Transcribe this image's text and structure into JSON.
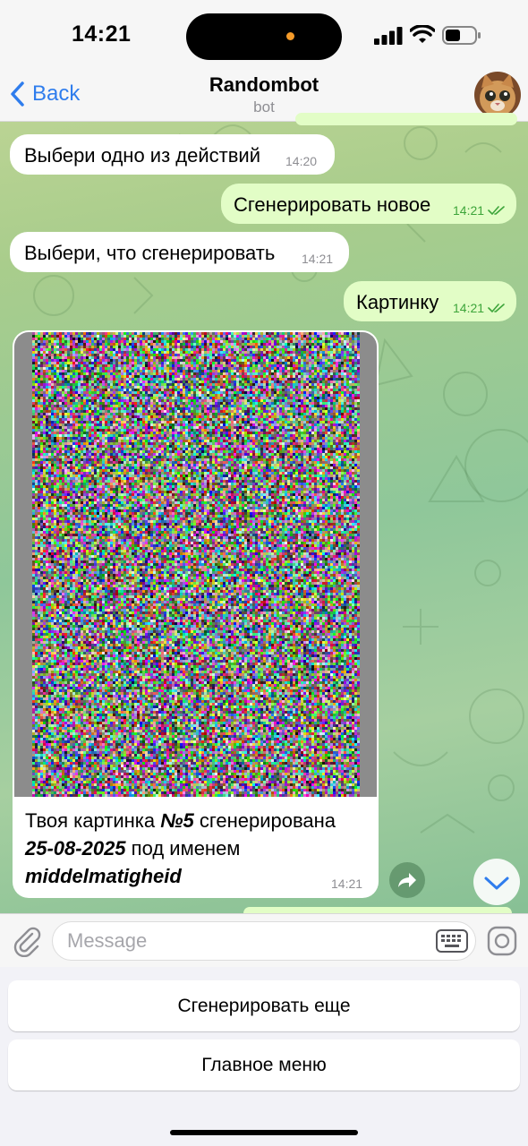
{
  "status_bar": {
    "time": "14:21"
  },
  "header": {
    "back_label": "Back",
    "title": "Randombot",
    "subtitle": "bot"
  },
  "messages": [
    {
      "direction": "in",
      "text": "Выбери одно из действий",
      "time": "14:20"
    },
    {
      "direction": "out",
      "text": "Сгенерировать новое",
      "time": "14:21"
    },
    {
      "direction": "in",
      "text": "Выбери, что сгенерировать",
      "time": "14:21"
    },
    {
      "direction": "out",
      "text": "Картинку",
      "time": "14:21"
    }
  ],
  "image_message": {
    "caption_part1": "Твоя картинка ",
    "caption_number": "№5",
    "caption_part2": " сгенерирована",
    "caption_date": "25-08-2025",
    "caption_part3": " под именем",
    "caption_name": "middelmatigheid",
    "time": "14:21"
  },
  "input": {
    "placeholder": "Message",
    "value": ""
  },
  "reply_keyboard": {
    "buttons": [
      "Сгенерировать еще",
      "Главное меню"
    ]
  },
  "colors": {
    "accent": "#2f7ded",
    "outgoing_bubble": "#e2fdc6",
    "incoming_bubble": "#ffffff",
    "check_green": "#3da53a"
  }
}
